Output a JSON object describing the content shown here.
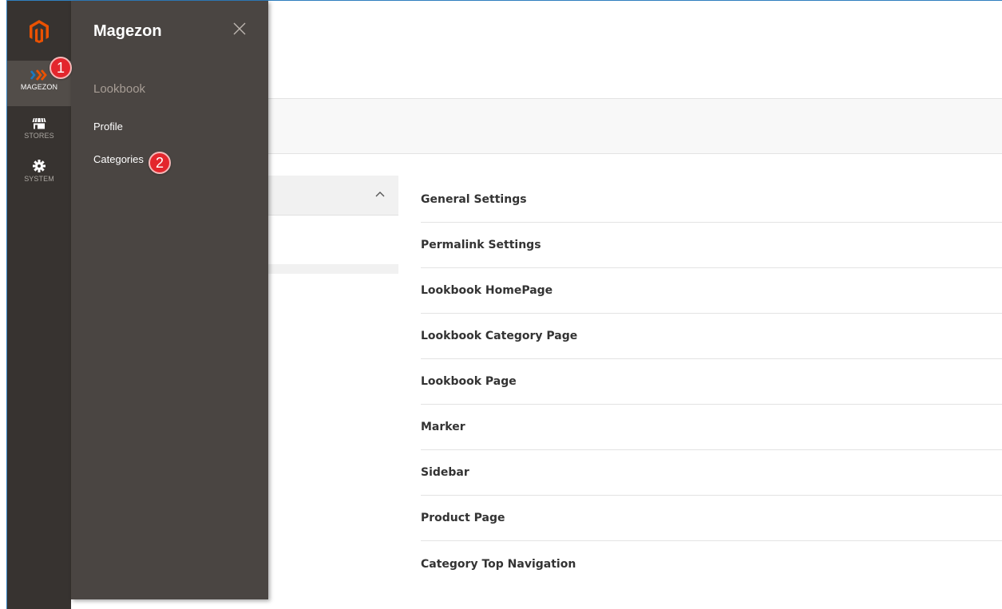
{
  "admin_nav": {
    "items": [
      {
        "id": "magezon",
        "label": "MAGEZON",
        "icon": "magezon-chevrons-icon"
      },
      {
        "id": "stores",
        "label": "STORES",
        "icon": "store-icon"
      },
      {
        "id": "system",
        "label": "SYSTEM",
        "icon": "gear-icon"
      }
    ]
  },
  "submenu": {
    "title": "Magezon",
    "section": "Lookbook",
    "links": [
      "Profile",
      "Categories"
    ]
  },
  "callouts": [
    "1",
    "2"
  ],
  "settings": {
    "items": [
      "General Settings",
      "Permalink Settings",
      "Lookbook HomePage",
      "Lookbook Category Page",
      "Lookbook Page",
      "Marker",
      "Sidebar",
      "Product Page",
      "Category Top Navigation"
    ]
  },
  "colors": {
    "nav_bg": "#373330",
    "nav_active": "#524d49",
    "submenu_bg": "#4a4542",
    "magento_orange": "#eb5202",
    "callout_red": "#e3262d"
  }
}
